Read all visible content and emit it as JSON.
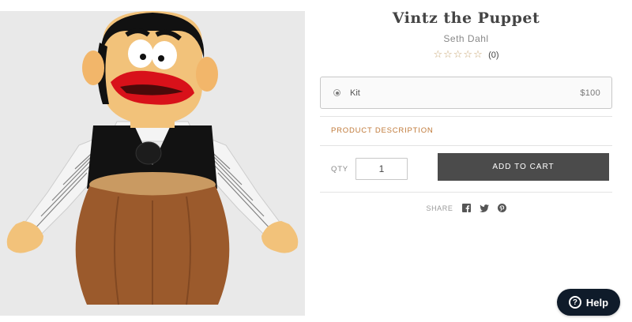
{
  "product": {
    "title": "Vintz the Puppet",
    "author": "Seth Dahl",
    "rating": {
      "stars_text": "☆☆☆☆☆",
      "filled_stars": 0,
      "max_stars": 5,
      "review_count": "(0)"
    },
    "image": {
      "alt_icon": "puppet-product-image",
      "background": "#e9e9e9"
    }
  },
  "variant": {
    "label": "Kit",
    "price": "$100",
    "selected": true
  },
  "tabs": {
    "description_label": "PRODUCT DESCRIPTION"
  },
  "purchase": {
    "qty_label": "QTY",
    "qty_value": "1",
    "add_to_cart_label": "ADD TO CART"
  },
  "share": {
    "label": "SHARE",
    "icons": [
      "facebook-icon",
      "twitter-icon",
      "pinterest-icon"
    ]
  },
  "help": {
    "icon_text": "?",
    "label": "Help"
  },
  "colors": {
    "accent": "#c07a3a",
    "button": "#4b4b4b",
    "help_bg": "#0f1b2a",
    "star": "#c9a877"
  }
}
